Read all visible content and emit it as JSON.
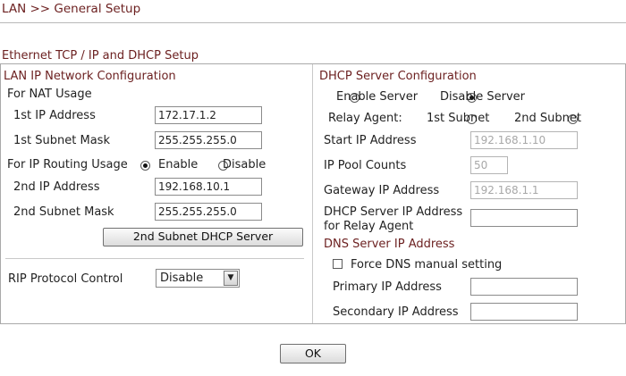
{
  "breadcrumb": "LAN >> General Setup",
  "section_title": "Ethernet TCP / IP and DHCP Setup",
  "lan": {
    "header": "LAN IP Network Configuration",
    "nat_usage": "For NAT Usage",
    "ip1_label": "1st IP Address",
    "ip1_value": "172.17.1.2",
    "mask1_label": "1st Subnet Mask",
    "mask1_value": "255.255.255.0",
    "routing_label": "For IP Routing Usage",
    "routing_enable": "Enable",
    "routing_disable": "Disable",
    "routing_selected": "Enable",
    "ip2_label": "2nd IP Address",
    "ip2_value": "192.168.10.1",
    "mask2_label": "2nd Subnet Mask",
    "mask2_value": "255.255.255.0",
    "dhcp2_button": "2nd Subnet DHCP Server",
    "rip_label": "RIP Protocol Control",
    "rip_value": "Disable"
  },
  "dhcp": {
    "header": "DHCP Server Configuration",
    "enable_label": "Enable Server",
    "disable_label": "Disable Server",
    "server_selected": "Disable Server",
    "relay_label": "Relay Agent:",
    "relay_1st": "1st Subnet",
    "relay_2nd": "2nd Subnet",
    "start_ip_label": "Start IP Address",
    "start_ip_value": "192.168.1.10",
    "pool_label": "IP Pool Counts",
    "pool_value": "50",
    "gateway_label": "Gateway IP Address",
    "gateway_value": "192.168.1.1",
    "relay_ip_label_1": "DHCP Server IP Address",
    "relay_ip_label_2": "for Relay Agent",
    "relay_ip_value": ""
  },
  "dns": {
    "header": "DNS Server IP Address",
    "force_label": "Force DNS manual setting",
    "force_checked": false,
    "primary_label": "Primary IP Address",
    "primary_value": "",
    "secondary_label": "Secondary IP Address",
    "secondary_value": ""
  },
  "ok_button": "OK"
}
